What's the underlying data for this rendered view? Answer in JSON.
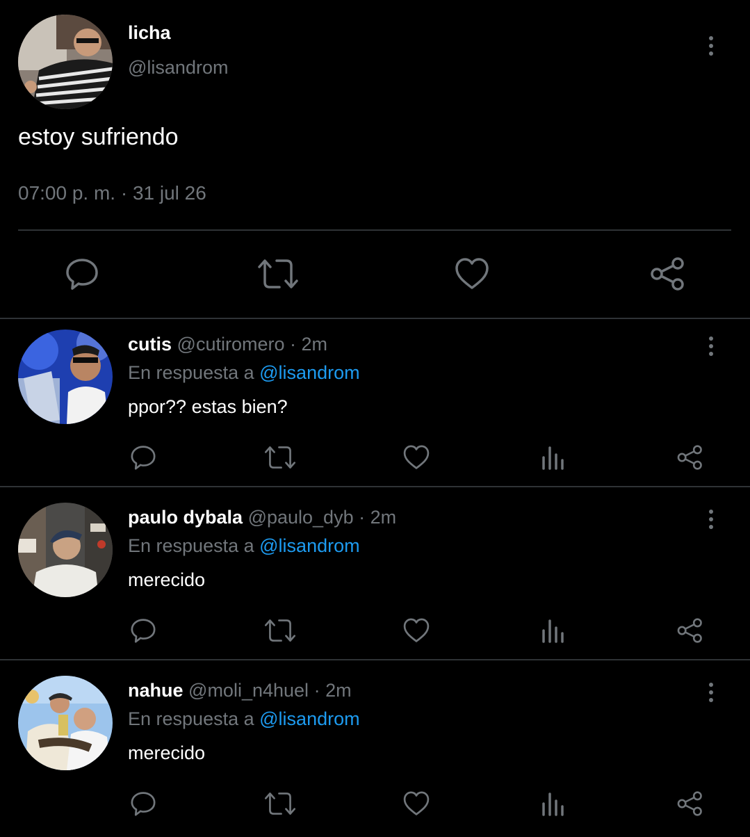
{
  "main_tweet": {
    "display_name": "licha",
    "handle": "@lisandrom",
    "text": "estoy sufriendo",
    "timestamp": "07:00 p. m. · 31 jul 26",
    "actions": [
      "reply-icon",
      "retweet-icon",
      "like-icon",
      "share-icon"
    ]
  },
  "replies": [
    {
      "display_name": "cutis",
      "handle": "@cutiromero",
      "separator": "·",
      "time": "2m",
      "context_prefix": "En respuesta a",
      "mention": "@lisandrom",
      "text": "ppor?? estas bien?"
    },
    {
      "display_name": "paulo dybala",
      "handle": "@paulo_dyb",
      "separator": "·",
      "time": "2m",
      "context_prefix": "En respuesta a",
      "mention": "@lisandrom",
      "text": "merecido"
    },
    {
      "display_name": "nahue",
      "handle": "@moli_n4huel",
      "separator": "·",
      "time": "2m",
      "context_prefix": "En respuesta a",
      "mention": "@lisandrom",
      "text": "merecido"
    }
  ],
  "reply_actions": [
    "reply-icon",
    "retweet-icon",
    "like-icon",
    "views-icon",
    "share-icon"
  ],
  "colors": {
    "background": "#000000",
    "primary_text": "#ffffff",
    "secondary_text": "#71767b",
    "mention": "#1d9bf0",
    "divider": "#2f3336"
  }
}
